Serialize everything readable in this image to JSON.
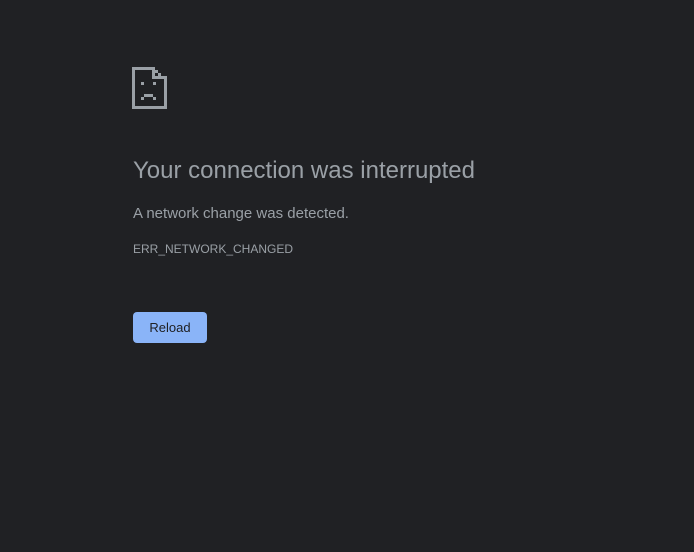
{
  "icon": {
    "name": "sad-document-icon",
    "color": "#9aa0a6"
  },
  "main": {
    "title": "Your connection was interrupted",
    "message": "A network change was detected.",
    "error_code": "ERR_NETWORK_CHANGED"
  },
  "actions": {
    "reload_label": "Reload"
  },
  "colors": {
    "background": "#202124",
    "text": "#9aa0a6",
    "button_background": "#8ab4f8",
    "button_text": "#202124"
  }
}
